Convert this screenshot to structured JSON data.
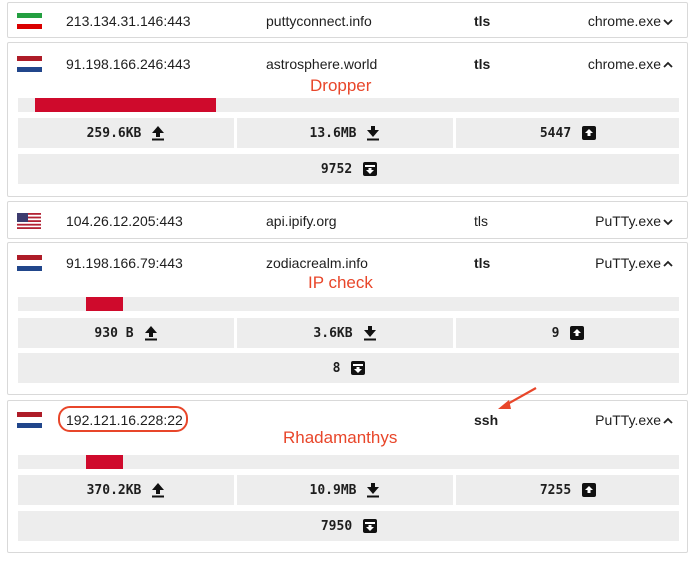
{
  "rows": [
    {
      "ip": "213.134.31.146:443",
      "domain": "puttyconnect.info",
      "protocol": "tls",
      "process": "chrome.exe",
      "flag": "flag-iran-icon",
      "expanded": false
    },
    {
      "ip": "91.198.166.246:443",
      "domain": "astrosphere.world",
      "protocol": "tls",
      "process": "chrome.exe",
      "flag": "flag-netherlands-icon",
      "expanded": true,
      "note": "Dropper",
      "bar_fraction": 0.27,
      "stats": {
        "sent": "259.6KB",
        "received": "13.6MB",
        "packets_out": "5447",
        "packets_in": "9752"
      }
    },
    {
      "ip": "104.26.12.205:443",
      "domain": "api.ipify.org",
      "protocol": "tls",
      "process": "PuTTy.exe",
      "flag": "flag-usa-icon",
      "expanded": false
    },
    {
      "ip": "91.198.166.79:443",
      "domain": "zodiacrealm.info",
      "protocol": "tls",
      "process": "PuTTy.exe",
      "flag": "flag-netherlands-icon",
      "expanded": true,
      "note": "IP check",
      "bar_fraction": 0.055,
      "stats": {
        "sent": "930 B",
        "received": "3.6KB",
        "packets_out": "9",
        "packets_in": "8"
      }
    },
    {
      "ip": "192.121.16.228:22",
      "domain": "",
      "protocol": "ssh",
      "process": "PuTTy.exe",
      "flag": "flag-netherlands-icon",
      "expanded": true,
      "note": "Rhadamanthys",
      "bar_fraction": 0.055,
      "stats": {
        "sent": "370.2KB",
        "received": "10.9MB",
        "packets_out": "7255",
        "packets_in": "7950"
      }
    }
  ],
  "colors": {
    "accent_red": "#cf0a2c",
    "annotation": "#e8462a",
    "stat_bg": "#ededed"
  }
}
